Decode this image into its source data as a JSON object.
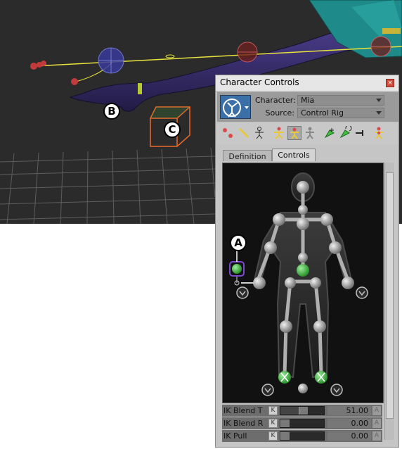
{
  "callouts": {
    "a": "A",
    "b": "B",
    "c": "C"
  },
  "panel": {
    "title": "Character Controls",
    "close_icon": "close-icon",
    "character_label": "Character:",
    "character_value": "Mia",
    "source_label": "Source:",
    "source_value": "Control Rig",
    "tabs": [
      {
        "label": "Definition"
      },
      {
        "label": "Controls",
        "active": true
      }
    ],
    "toolbar_icons": [
      "effector-selection-icon",
      "bone-selection-icon",
      "skeleton-icon",
      "full-body-ik-icon",
      "body-part-ik-icon",
      "stance-pose-icon",
      "pin-translation-icon",
      "pin-rotation-icon",
      "release-pin-icon",
      "show-effectors-icon"
    ],
    "properties": [
      {
        "label": "IK Blend T",
        "key": "K",
        "value": "51.00",
        "level": 0.51,
        "anim": "A"
      },
      {
        "label": "IK Blend R",
        "key": "K",
        "value": "0.00",
        "level": 0.0,
        "anim": "A"
      },
      {
        "label": "IK Pull",
        "key": "K",
        "value": "0.00",
        "level": 0.0,
        "anim": "A"
      }
    ]
  },
  "colors": {
    "accent_green": "#3fbf3f",
    "selection_purple": "#7d4bd1",
    "effector_red": "#d94a4a",
    "ik_yellow": "#e8e23c",
    "box_orange": "#f06a2a"
  }
}
